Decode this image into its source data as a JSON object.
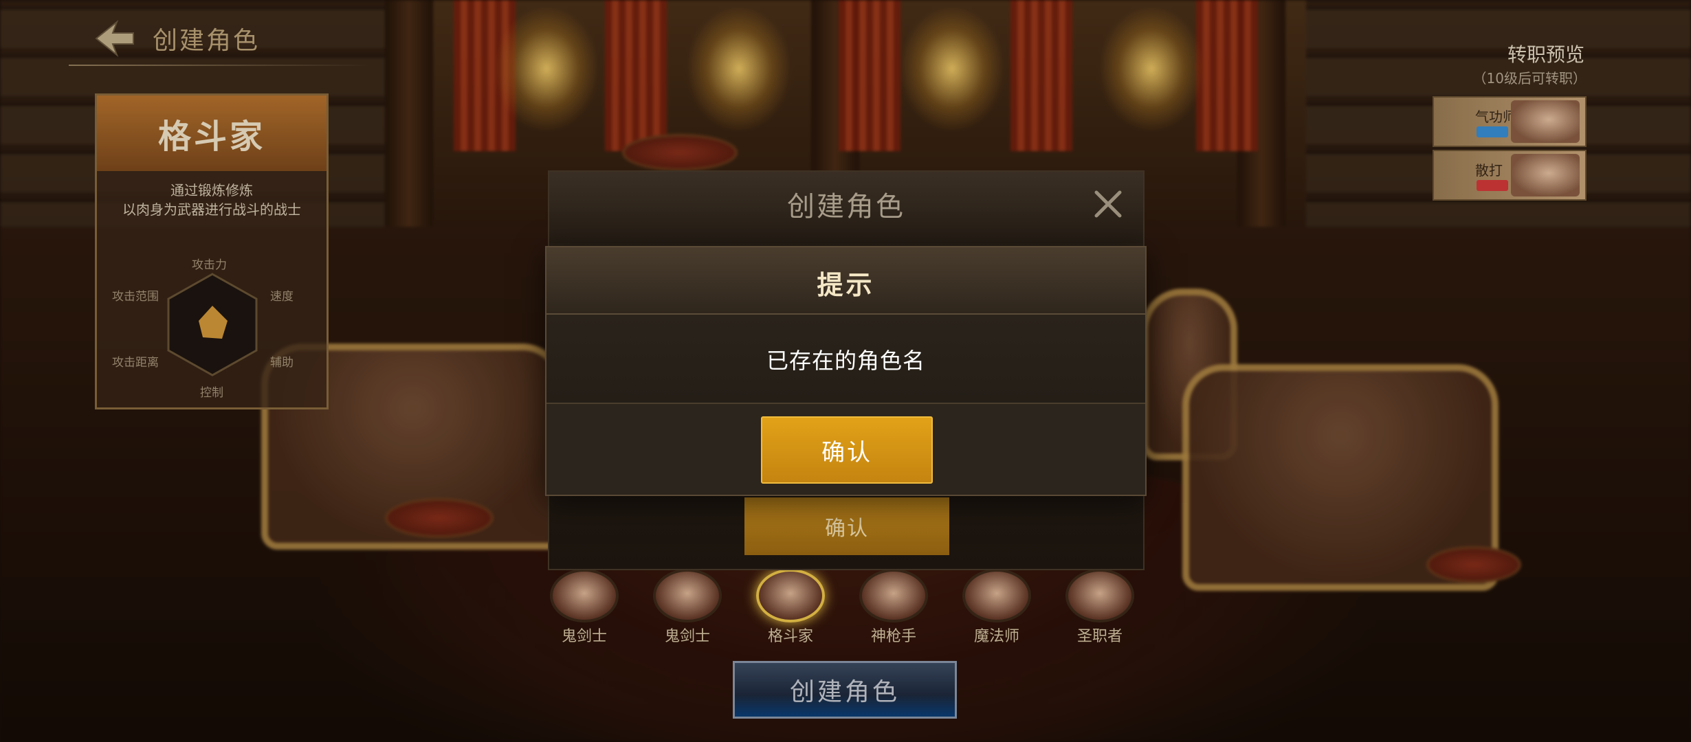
{
  "header": {
    "title": "创建角色"
  },
  "class_panel": {
    "class_name": "格斗家",
    "description_lines": [
      "通过锻炼修炼",
      "以肉身为武器进行战斗的战士"
    ],
    "stats": {
      "top": "攻击力",
      "left_top": "攻击范围",
      "right_top": "速度",
      "left_bottom": "攻击距离",
      "right_bottom": "辅助",
      "bottom": "控制"
    }
  },
  "job_preview": {
    "title": "转职预览",
    "subtitle": "（10级后可转职）",
    "cards": [
      {
        "name": "气功师",
        "badge_color": "#3a8fd6"
      },
      {
        "name": "散打",
        "badge_color": "#d63a3a"
      }
    ]
  },
  "characters": [
    {
      "label": "鬼剑士",
      "selected": false
    },
    {
      "label": "鬼剑士",
      "selected": false
    },
    {
      "label": "格斗家",
      "selected": true
    },
    {
      "label": "神枪手",
      "selected": false
    },
    {
      "label": "魔法师",
      "selected": false
    },
    {
      "label": "圣职者",
      "selected": false
    }
  ],
  "create_button": "创建角色",
  "create_dialog": {
    "title": "创建角色",
    "confirm_label": "确认"
  },
  "hint_dialog": {
    "title": "提示",
    "message": "已存在的角色名",
    "confirm_label": "确认"
  },
  "colors": {
    "confirm_gold": "#d4931a",
    "hint_title": "#f3e7c6"
  }
}
